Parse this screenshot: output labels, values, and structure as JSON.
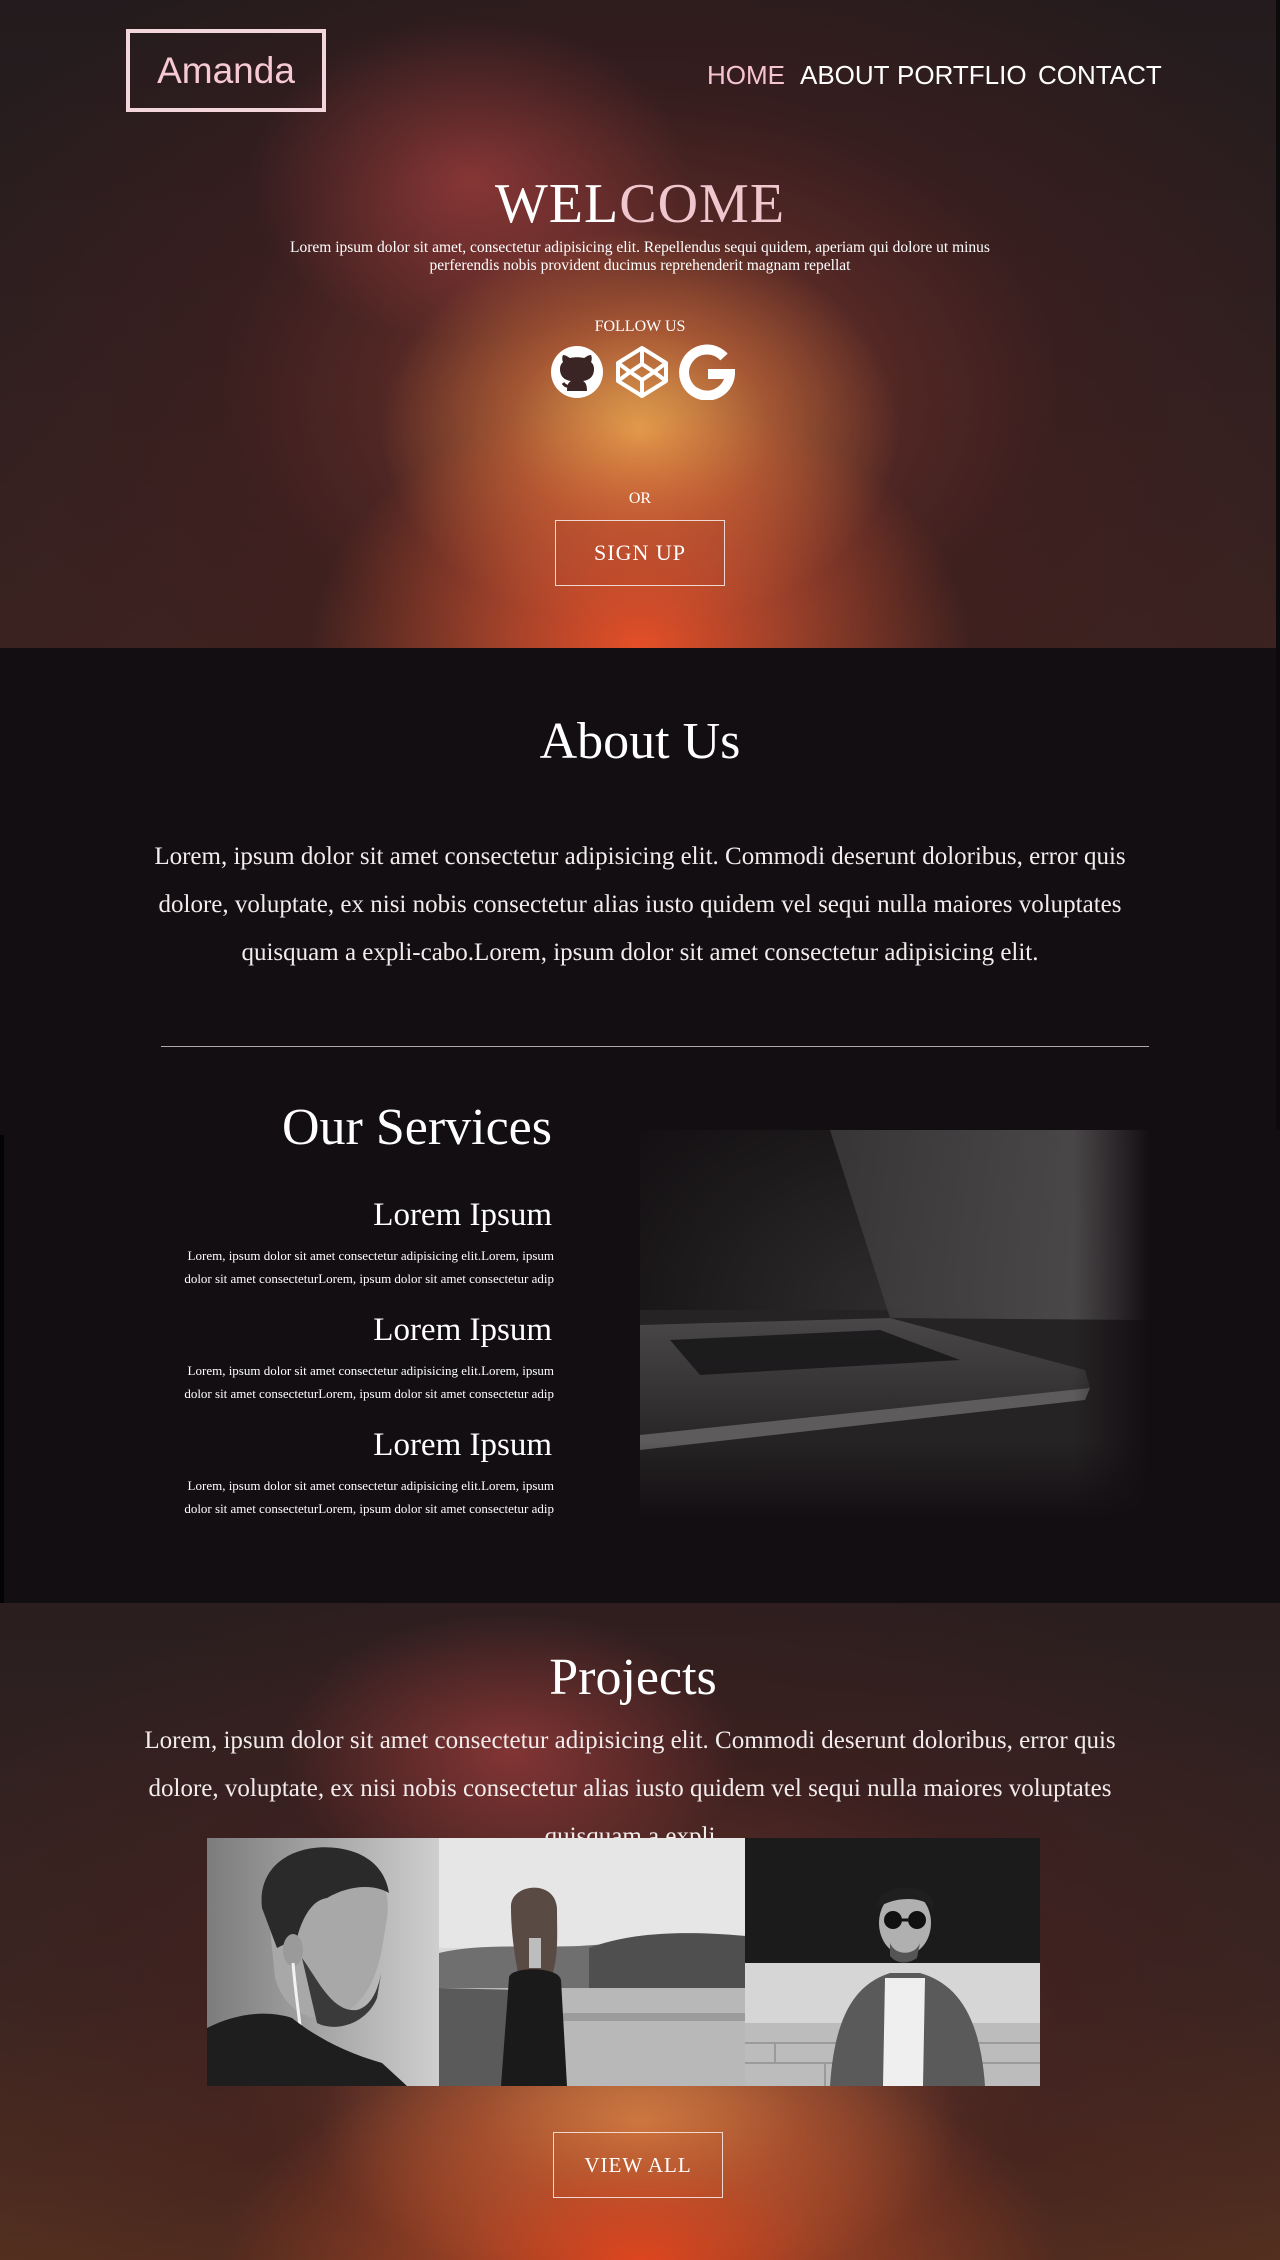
{
  "header": {
    "logo": "Amanda",
    "nav": [
      {
        "label": "HOME",
        "active": true
      },
      {
        "label": "ABOUT"
      },
      {
        "label": "PORTFLIO"
      },
      {
        "label": "CONTACT"
      }
    ]
  },
  "hero": {
    "welcome_part1": "WEL",
    "welcome_part2": "COME",
    "description": "Lorem ipsum dolor sit amet, consectetur adipisicing elit. Repellendus sequi quidem, aperiam qui dolore ut minus perferendis nobis provident ducimus reprehenderit magnam repellat",
    "follow_label": "FOLLOW US",
    "social_icons": [
      "github-icon",
      "codepen-icon",
      "google-icon"
    ],
    "or_label": "OR",
    "signup_label": "SIGN  UP"
  },
  "about": {
    "title": "About Us",
    "text": "Lorem, ipsum dolor sit amet consectetur adipisicing elit. Commodi deserunt doloribus, error quis dolore, voluptate, ex nisi nobis consectetur alias iusto quidem vel sequi nulla maiores voluptates quisquam a expli-cabo.Lorem, ipsum dolor sit amet consectetur adipisicing elit."
  },
  "services": {
    "title": "Our Services",
    "items": [
      {
        "heading": "Lorem Ipsum",
        "text": "Lorem, ipsum dolor sit amet consectetur adipisicing elit.Lorem, ipsum dolor sit amet consecteturLorem, ipsum dolor sit amet consectetur adip"
      },
      {
        "heading": "Lorem Ipsum",
        "text": "Lorem, ipsum dolor sit amet consectetur adipisicing elit.Lorem, ipsum dolor sit amet consecteturLorem, ipsum dolor sit amet consectetur adip"
      },
      {
        "heading": "Lorem Ipsum",
        "text": "Lorem, ipsum dolor sit amet consectetur adipisicing elit.Lorem, ipsum dolor sit amet consecteturLorem, ipsum dolor sit amet consectetur adip"
      }
    ]
  },
  "projects": {
    "title": "Projects",
    "text": "Lorem, ipsum dolor sit amet consectetur adipisicing elit. Commodi deserunt doloribus, error quis dolore, voluptate, ex nisi nobis consectetur alias iusto quidem vel sequi nulla maiores voluptates quisquam a expli",
    "view_all_label": "VIEW ALL"
  },
  "colors": {
    "accent_pink": "#f6c9d5",
    "background_dark": "#120e11",
    "sunset_orange": "#e8522a"
  }
}
